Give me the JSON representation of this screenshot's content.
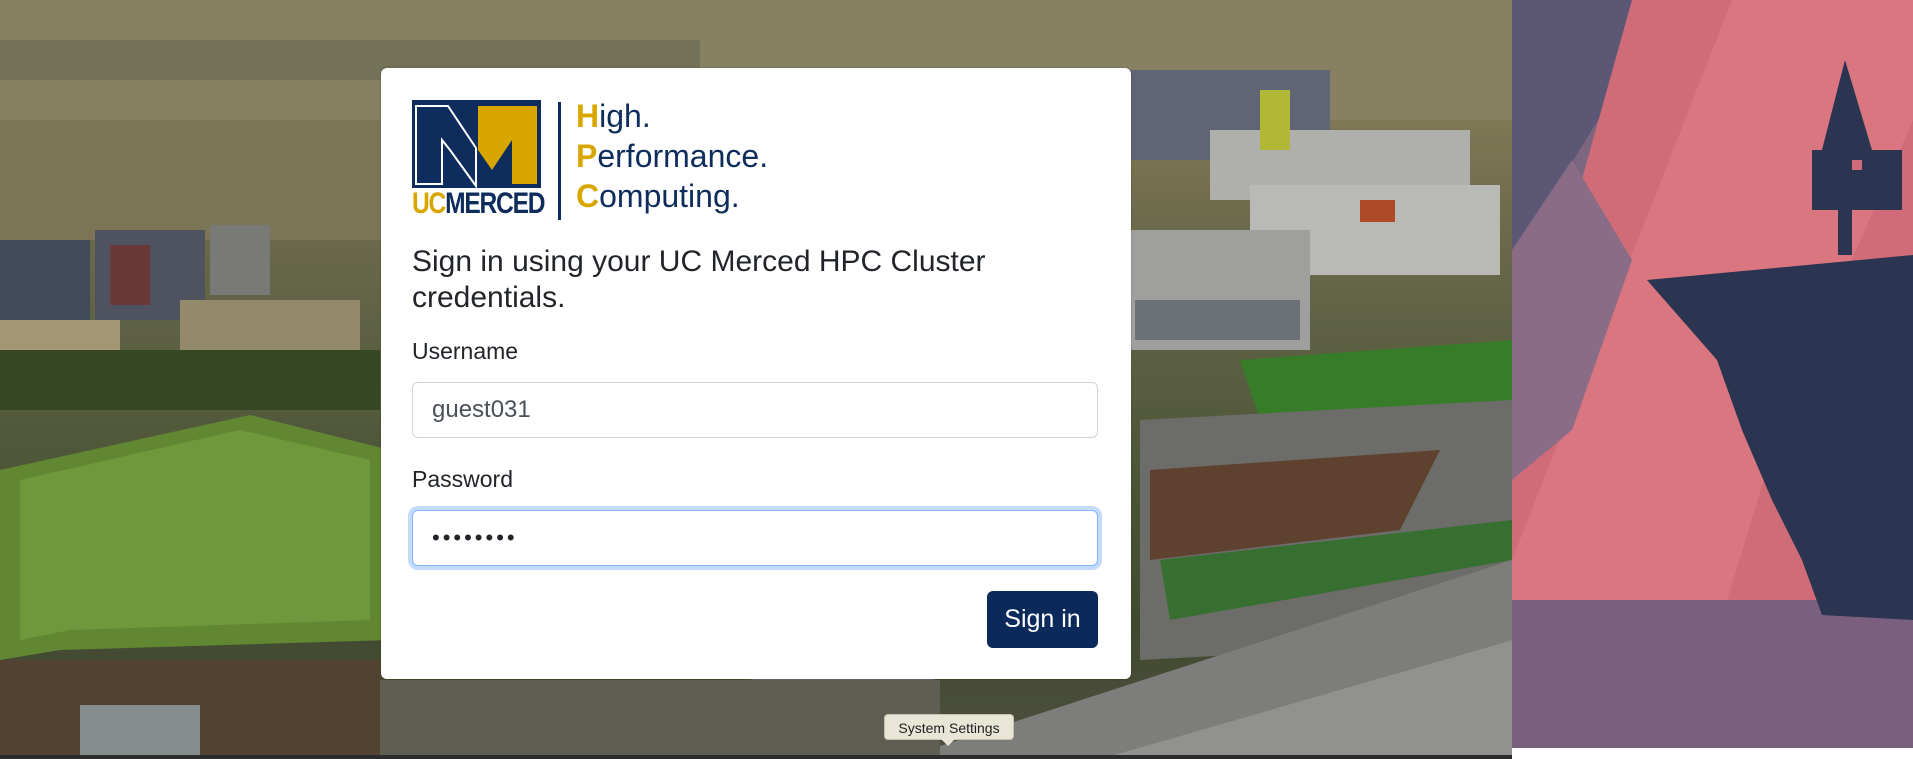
{
  "brand": {
    "uc_text": "UC",
    "merced_text": "MERCED",
    "hpc_lines": [
      {
        "initial": "H",
        "rest": "igh."
      },
      {
        "initial": "P",
        "rest": "erformance."
      },
      {
        "initial": "C",
        "rest": "omputing."
      }
    ],
    "colors": {
      "navy": "#0f2d5c",
      "gold": "#d9a600"
    }
  },
  "login": {
    "heading": "Sign in using your UC Merced HPC Cluster credentials.",
    "username_label": "Username",
    "username_value": "guest031",
    "password_label": "Password",
    "password_value": "••••••••",
    "submit_label": "Sign in"
  },
  "tooltip": {
    "text": "System Settings"
  },
  "colors": {
    "button_bg": "#0b2a5b",
    "focus_ring": "#86b7fe",
    "wallpaper_pink": "#d4717b",
    "wallpaper_navy": "#2b3450"
  }
}
